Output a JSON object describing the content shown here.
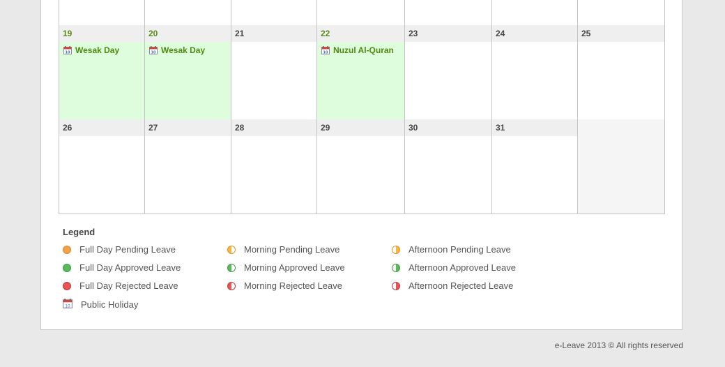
{
  "calendar": {
    "weeks": [
      {
        "days": [
          {
            "day": "",
            "event": ""
          },
          {
            "day": "",
            "event": ""
          },
          {
            "day": "",
            "event": ""
          },
          {
            "day": "",
            "event": ""
          },
          {
            "day": "",
            "event": ""
          },
          {
            "day": "",
            "event": ""
          },
          {
            "day": "",
            "event": ""
          }
        ]
      },
      {
        "days": [
          {
            "day": "19",
            "event": "Wesak Day",
            "holiday": true
          },
          {
            "day": "20",
            "event": "Wesak Day",
            "holiday": true
          },
          {
            "day": "21",
            "event": ""
          },
          {
            "day": "22",
            "event": "Nuzul Al-Quran",
            "holiday": true
          },
          {
            "day": "23",
            "event": ""
          },
          {
            "day": "24",
            "event": ""
          },
          {
            "day": "25",
            "event": ""
          }
        ]
      },
      {
        "days": [
          {
            "day": "26",
            "event": ""
          },
          {
            "day": "27",
            "event": ""
          },
          {
            "day": "28",
            "event": ""
          },
          {
            "day": "29",
            "event": ""
          },
          {
            "day": "30",
            "event": ""
          },
          {
            "day": "31",
            "event": ""
          },
          {
            "day": "",
            "event": "",
            "empty": true
          }
        ]
      }
    ]
  },
  "legend": {
    "title": "Legend",
    "items": [
      {
        "label": "Full Day Pending Leave",
        "icon": "full-pending-dot",
        "color": "#f5a04a"
      },
      {
        "label": "Full Day Approved Leave",
        "icon": "full-approved-dot",
        "color": "#5cb85c"
      },
      {
        "label": "Full Day Rejected Leave",
        "icon": "full-rejected-dot",
        "color": "#e45555"
      },
      {
        "label": "Public Holiday",
        "icon": "calendar-icon"
      },
      {
        "label": "Morning Pending Leave",
        "icon": "morning-pending-dot",
        "color": "#f5b642"
      },
      {
        "label": "Morning Approved Leave",
        "icon": "morning-approved-dot",
        "color": "#5cb85c"
      },
      {
        "label": "Morning Rejected Leave",
        "icon": "morning-rejected-dot",
        "color": "#e45555"
      },
      {
        "label": "Afternoon Pending Leave",
        "icon": "afternoon-pending-dot",
        "color": "#f5b642"
      },
      {
        "label": "Afternoon Approved Leave",
        "icon": "afternoon-approved-dot",
        "color": "#5cb85c"
      },
      {
        "label": "Afternoon Rejected Leave",
        "icon": "afternoon-rejected-dot",
        "color": "#e45555"
      }
    ]
  },
  "footer": {
    "text": "e-Leave 2013 © All rights reserved"
  }
}
